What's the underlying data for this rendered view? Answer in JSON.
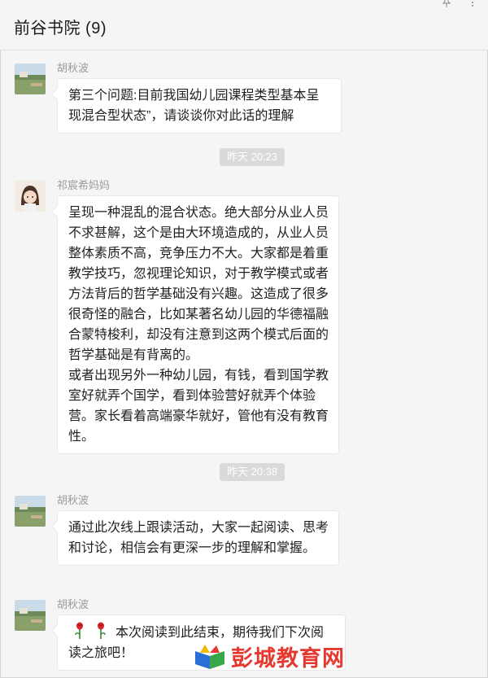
{
  "window": {
    "title": "前谷书院 (9)"
  },
  "messages": [
    {
      "sender": "胡秋波",
      "text": "第三个问题:目前我国幼儿园课程类型基本呈现混合型状态”，请谈谈你对此话的理解"
    },
    {
      "time": "昨天 20:23"
    },
    {
      "sender": "祁宸希妈妈",
      "paragraphs": [
        "呈现一种混乱的混合状态。绝大部分从业人员不求甚解，这个是由大环境造成的，从业人员整体素质不高，竞争压力不大。大家都是着重教学技巧，忽视理论知识，对于教学模式或者方法背后的哲学基础没有兴趣。这造成了很多很奇怪的融合，比如某著名幼儿园的华德福融合蒙特梭利，却没有注意到这两个模式后面的哲学基础是有背离的。",
        "或者出现另外一种幼儿园，有钱，看到国学教室好就弄个国学，看到体验营好就弄个体验营。家长看着高端豪华就好，管他有没有教育性。"
      ]
    },
    {
      "time": "昨天 20:38"
    },
    {
      "sender": "胡秋波",
      "text": "通过此次线上跟读活动，大家一起阅读、思考和讨论，相信会有更深一步的理解和掌握。"
    },
    {
      "sender": "胡秋波",
      "text": "本次阅读到此结束，期待我们下次阅读之旅吧！"
    }
  ],
  "icons": {
    "pin": "pin-icon",
    "more": "more-icon",
    "flower": "rose-icon"
  },
  "watermark": {
    "text": "彭城教育网"
  },
  "colors": {
    "bubble": "#ffffff",
    "background": "#f5f5f5",
    "time_badge": "#dadada",
    "watermark": "#e5382f"
  }
}
